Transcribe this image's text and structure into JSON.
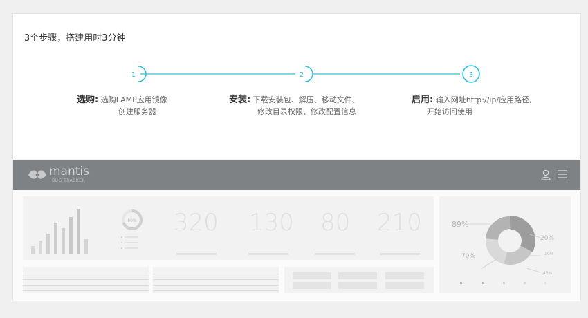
{
  "heading": "3个步骤，搭建用时3分钟",
  "steps": [
    {
      "num": "1",
      "title": "选购:",
      "line1": "选购LAMP应用镜像",
      "line2": "创建服务器"
    },
    {
      "num": "2",
      "title": "安装:",
      "line1": "下载安装包、解压、移动文件、",
      "line2": "修改目录权限、修改配置信息"
    },
    {
      "num": "3",
      "title": "启用:",
      "line1": "输入网址http://ip/应用路径,",
      "line2": "开始访问使用"
    }
  ],
  "app": {
    "name": "mantis",
    "subtitle": "BUG TRACKER"
  },
  "dashboard": {
    "gauge_label": "80%",
    "stats": [
      "320",
      "130",
      "80",
      "210"
    ],
    "donut": {
      "left_top": "89%",
      "left_bottom": "70%",
      "right_top": "20%",
      "right_mid": "30%",
      "right_bottom": "45%"
    }
  },
  "colors": {
    "accent": "#2ec3d6",
    "appbar": "#7f8284"
  }
}
